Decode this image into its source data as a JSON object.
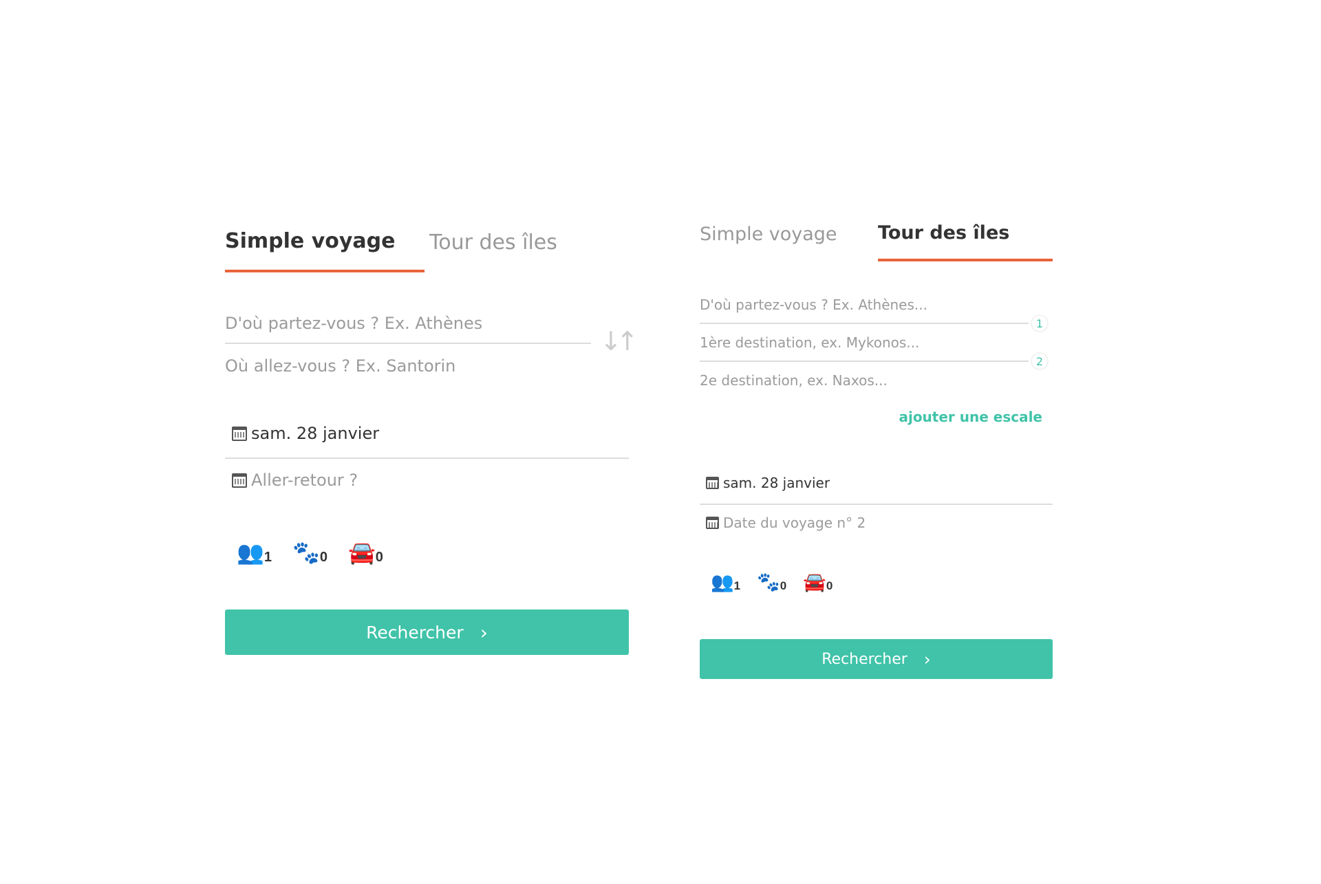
{
  "left": {
    "tabs": [
      {
        "label": "Simple voyage"
      },
      {
        "label": "Tour des îles"
      }
    ],
    "from_placeholder": "D'où partez-vous ? Ex. Athènes",
    "to_placeholder": "Où allez-vous ? Ex. Santorin",
    "swap_icon": "swap-vertical-icon",
    "depart_date": "sam. 28 janvier",
    "return_placeholder": "Aller-retour ?",
    "counters": {
      "passengers": "1",
      "pets": "0",
      "vehicles": "0"
    },
    "search_label": "Rechercher"
  },
  "right": {
    "tabs": [
      {
        "label": "Simple voyage"
      },
      {
        "label": "Tour des îles"
      }
    ],
    "from_placeholder": "D'où partez-vous ? Ex. Athènes...",
    "dest1_placeholder": "1ère destination, ex. Mykonos...",
    "dest2_placeholder": "2e destination, ex. Naxos...",
    "stop_numbers": [
      "1",
      "2"
    ],
    "add_stop_label": "ajouter une escale",
    "date1": "sam. 28 janvier",
    "date2_placeholder": "Date du voyage n° 2",
    "counters": {
      "passengers": "1",
      "pets": "0",
      "vehicles": "0"
    },
    "search_label": "Rechercher"
  },
  "colors": {
    "accent": "#e8643a",
    "primary": "#40c3a8",
    "muted": "#9b9b9b"
  }
}
